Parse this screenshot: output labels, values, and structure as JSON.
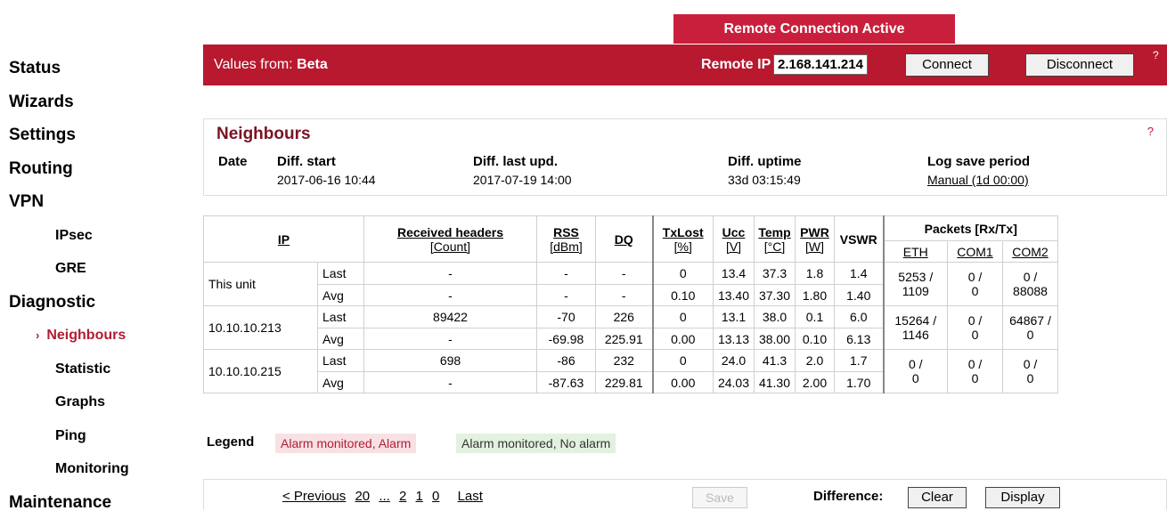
{
  "sidebar": {
    "items": [
      {
        "label": "Status",
        "level": 1
      },
      {
        "label": "Wizards",
        "level": 1
      },
      {
        "label": "Settings",
        "level": 1
      },
      {
        "label": "Routing",
        "level": 1
      },
      {
        "label": "VPN",
        "level": 1
      },
      {
        "label": "IPsec",
        "level": 2
      },
      {
        "label": "GRE",
        "level": 2
      },
      {
        "label": "Diagnostic",
        "level": 1
      },
      {
        "label": "Neighbours",
        "level": 2,
        "active": true
      },
      {
        "label": "Statistic",
        "level": 2
      },
      {
        "label": "Graphs",
        "level": 2
      },
      {
        "label": "Ping",
        "level": 2
      },
      {
        "label": "Monitoring",
        "level": 2
      },
      {
        "label": "Maintenance",
        "level": 1
      }
    ],
    "active_marker": "›"
  },
  "banner": {
    "text": "Remote Connection Active"
  },
  "topbar": {
    "values_from_label": "Values from:",
    "values_from_value": "Beta",
    "remote_ip_label": "Remote IP",
    "remote_ip_value": "2.168.141.214",
    "connect_label": "Connect",
    "disconnect_label": "Disconnect",
    "help_text": "?"
  },
  "panel": {
    "title": "Neighbours",
    "help": "?",
    "date_label": "Date",
    "diff_start_label": "Diff. start",
    "diff_start_value": "2017-06-16 10:44",
    "diff_last_label": "Diff. last upd.",
    "diff_last_value": "2017-07-19 14:00",
    "diff_uptime_label": "Diff. uptime",
    "diff_uptime_value": "33d 03:15:49",
    "log_label": "Log save period",
    "log_value": "Manual (1d 00:00)"
  },
  "table": {
    "headers": {
      "ip": "IP",
      "recv": "Received headers",
      "recv_unit": "[Count]",
      "rss": "RSS",
      "rss_unit": "[dBm]",
      "dq": "DQ",
      "txlost": "TxLost",
      "txlost_unit": "[%]",
      "ucc": "Ucc",
      "ucc_unit": "[V]",
      "temp": "Temp",
      "temp_unit": "[°C]",
      "pwr": "PWR",
      "pwr_unit": "[W]",
      "vswr": "VSWR",
      "packets": "Packets [Rx/Tx]",
      "eth": "ETH",
      "com1": "COM1",
      "com2": "COM2"
    },
    "rows": [
      {
        "ip": "This unit",
        "last": {
          "label": "Last",
          "recv": "-",
          "rss": "-",
          "dq": "-",
          "txlost": "0",
          "ucc": "13.4",
          "temp": "37.3",
          "pwr": "1.8",
          "vswr": "1.4"
        },
        "avg": {
          "label": "Avg",
          "recv": "-",
          "rss": "-",
          "dq": "-",
          "txlost": "0.10",
          "ucc": "13.40",
          "temp": "37.30",
          "pwr": "1.80",
          "vswr": "1.40"
        },
        "eth": [
          "5253 /",
          "1109"
        ],
        "com1": [
          "0 /",
          "0"
        ],
        "com2": [
          "0 /",
          "88088"
        ]
      },
      {
        "ip": "10.10.10.213",
        "last": {
          "label": "Last",
          "recv": "89422",
          "rss": "-70",
          "dq": "226",
          "txlost": "0",
          "ucc": "13.1",
          "temp": "38.0",
          "pwr": "0.1",
          "vswr": "6.0"
        },
        "avg": {
          "label": "Avg",
          "recv": "-",
          "rss": "-69.98",
          "dq": "225.91",
          "txlost": "0.00",
          "ucc": "13.13",
          "temp": "38.00",
          "pwr": "0.10",
          "vswr": "6.13"
        },
        "eth": [
          "15264 /",
          "1146"
        ],
        "com1": [
          "0 /",
          "0"
        ],
        "com2": [
          "64867 /",
          "0"
        ]
      },
      {
        "ip": "10.10.10.215",
        "last": {
          "label": "Last",
          "recv": "698",
          "rss": "-86",
          "dq": "232",
          "txlost": "0",
          "ucc": "24.0",
          "temp": "41.3",
          "pwr": "2.0",
          "vswr": "1.7"
        },
        "avg": {
          "label": "Avg",
          "recv": "-",
          "rss": "-87.63",
          "dq": "229.81",
          "txlost": "0.00",
          "ucc": "24.03",
          "temp": "41.30",
          "pwr": "2.00",
          "vswr": "1.70"
        },
        "eth": [
          "0 /",
          "0"
        ],
        "com1": [
          "0 /",
          "0"
        ],
        "com2": [
          "0 /",
          "0"
        ]
      }
    ]
  },
  "legend": {
    "label": "Legend",
    "alarm": "Alarm monitored, Alarm",
    "no_alarm": "Alarm monitored, No alarm"
  },
  "footer": {
    "previous": "< Previous",
    "pages": [
      "20",
      "...",
      "2",
      "1",
      "0"
    ],
    "last": "Last",
    "save": "Save",
    "difference_label": "Difference:",
    "clear": "Clear",
    "display": "Display"
  },
  "colors": {
    "brand": "#b8192f",
    "banner": "#c8203c",
    "title": "#7a1323"
  }
}
